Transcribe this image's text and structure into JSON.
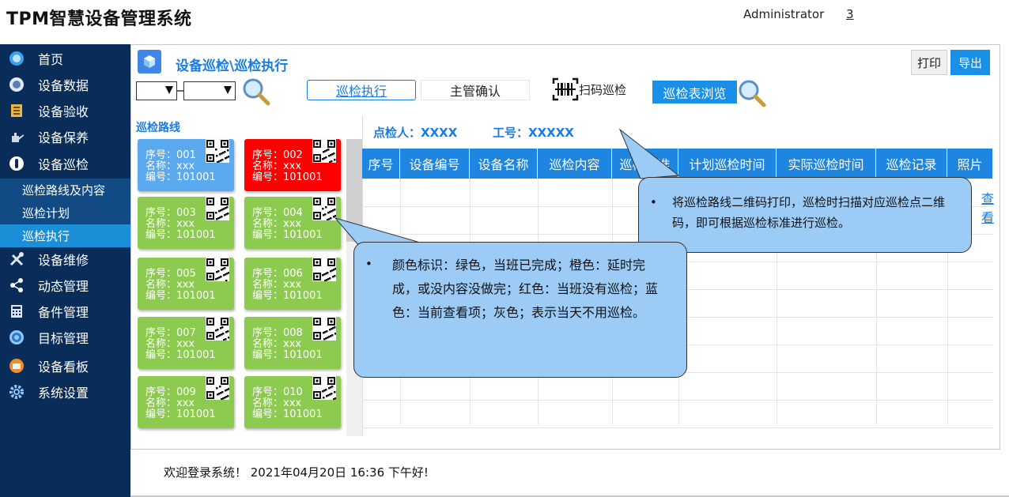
{
  "app_title": "TPM智慧设备管理系统",
  "user": {
    "name": "Administrator",
    "count": "3"
  },
  "nav": [
    {
      "label": "首页",
      "icon": "home-icon"
    },
    {
      "label": "设备数据",
      "icon": "database-icon"
    },
    {
      "label": "设备验收",
      "icon": "checklist-icon"
    },
    {
      "label": "设备保养",
      "icon": "oil-can-icon"
    },
    {
      "label": "设备巡检",
      "icon": "inspection-icon"
    },
    {
      "label": "设备维修",
      "icon": "tools-icon"
    },
    {
      "label": "动态管理",
      "icon": "share-nodes-icon"
    },
    {
      "label": "备件管理",
      "icon": "calculator-icon"
    },
    {
      "label": "目标管理",
      "icon": "target-icon"
    },
    {
      "label": "设备看板",
      "icon": "dashboard-icon"
    },
    {
      "label": "系统设置",
      "icon": "gear-icon"
    }
  ],
  "subnav": [
    {
      "label": "巡检路线及内容"
    },
    {
      "label": "巡检计划"
    },
    {
      "label": "巡检执行"
    }
  ],
  "breadcrumb": "设备巡检\\巡检执行",
  "toolbar": {
    "print": "打印",
    "export": "导出",
    "tab_exec": "巡检执行",
    "tab_confirm": "主管确认",
    "scan": "扫码巡检",
    "browse": "巡检表浏览"
  },
  "route": {
    "title": "巡检路线",
    "cards": [
      {
        "seq": "序号：001",
        "name": "名称：xxx",
        "code": "编号：101001",
        "color": "#5ba9ee"
      },
      {
        "seq": "序号：002",
        "name": "名称：xxx",
        "code": "编号：101001",
        "color": "#ff0000"
      },
      {
        "seq": "序号：003",
        "name": "名称：xxx",
        "code": "编号：101001",
        "color": "#8ccb4f"
      },
      {
        "seq": "序号：004",
        "name": "名称：xxx",
        "code": "编号：101001",
        "color": "#8ccb4f"
      },
      {
        "seq": "序号：005",
        "name": "名称：xxx",
        "code": "编号：101001",
        "color": "#8ccb4f"
      },
      {
        "seq": "序号：006",
        "name": "名称：xxx",
        "code": "编号：101001",
        "color": "#8ccb4f"
      },
      {
        "seq": "序号：007",
        "name": "名称：xxx",
        "code": "编号：101001",
        "color": "#8ccb4f"
      },
      {
        "seq": "序号：008",
        "name": "名称：xxx",
        "code": "编号：101001",
        "color": "#8ccb4f"
      },
      {
        "seq": "序号：009",
        "name": "名称：xxx",
        "code": "编号：101001",
        "color": "#8ccb4f"
      },
      {
        "seq": "序号：010",
        "name": "名称：xxx",
        "code": "编号：101001",
        "color": "#8ccb4f"
      }
    ]
  },
  "inspector": {
    "name": "点检人：XXXX",
    "id": "工号：XXXXX"
  },
  "table": {
    "columns": [
      "序号",
      "设备编号",
      "设备名称",
      "巡检内容",
      "巡检标准",
      "计划巡检时间",
      "实际巡检时间",
      "巡检记录",
      "照片"
    ],
    "view_link": "查看"
  },
  "callouts": {
    "qr": "将巡检路线二维码打印，巡检时扫描对应巡检点二维码，即可根据巡检标准进行巡检。",
    "color": "颜色标识：绿色，当班已完成；橙色：延时完成，或没内容没做完；红色：当班没有巡检；蓝色：当前查看项；灰色；表示当天不用巡检。",
    "bullet": "•"
  },
  "footer": "欢迎登录系统！ 2021年04月20日 16:36 下午好!"
}
